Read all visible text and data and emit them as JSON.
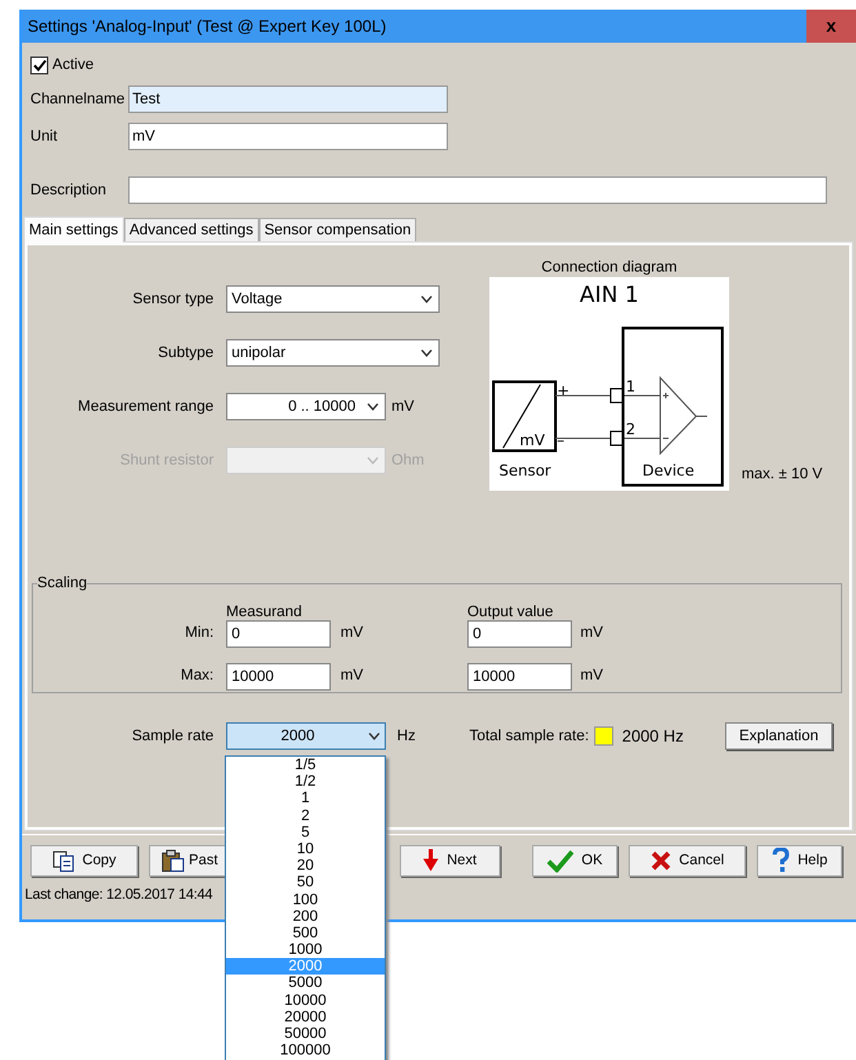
{
  "window": {
    "title": "Settings 'Analog-Input' (Test @ Expert Key 100L)",
    "close": "x"
  },
  "active": {
    "label": "Active",
    "checked": true
  },
  "fields": [
    {
      "label": "Channelname",
      "value": "Test",
      "focused": true,
      "kind": "short"
    },
    {
      "label": "Unit",
      "value": "mV",
      "focused": false,
      "kind": "short"
    },
    {
      "label": "Description",
      "focused": false,
      "kind": "wide"
    }
  ],
  "tabs": [
    {
      "label": "Main settings",
      "selected": true
    },
    {
      "label": "Advanced settings",
      "selected": false
    },
    {
      "label": "Sensor compensation",
      "selected": false
    }
  ],
  "settings": [
    {
      "label": "Sensor type",
      "value": "Voltage",
      "disabled": false,
      "kind": "wide"
    },
    {
      "label": "Subtype",
      "value": "unipolar",
      "disabled": false,
      "kind": "wide"
    },
    {
      "label": "Measurement range",
      "value": "0 .. 10000",
      "unit": "mV",
      "disabled": false,
      "kind": "narrow"
    },
    {
      "label": "Shunt resistor",
      "unit": "Ohm",
      "disabled": true,
      "kind": "narrow"
    }
  ],
  "diagram": {
    "title": "Connection diagram",
    "channel": "AIN 1",
    "plus": "+",
    "minus": "–",
    "pins": [
      "1",
      "2"
    ],
    "sensor_unit": "mV",
    "sensor_label": "Sensor",
    "device_label": "Device",
    "limit": "max. ± 10 V"
  },
  "scaling": {
    "title": "Scaling",
    "columns": [
      "Measurand",
      "Output value"
    ],
    "rows": [
      {
        "label": "Min:",
        "measurand": "0",
        "measurand_unit": "mV",
        "output": "0",
        "output_unit": "mV"
      },
      {
        "label": "Max:",
        "measurand": "10000",
        "measurand_unit": "mV",
        "output": "10000",
        "output_unit": "mV"
      }
    ]
  },
  "sample_rate": {
    "label": "Sample rate",
    "value": "2000",
    "unit": "Hz",
    "total_label": "Total sample rate:",
    "total_indicator": {
      "color": "#ffff00"
    },
    "total_value": "2000 Hz",
    "explanation": "Explanation",
    "options": [
      {
        "label": "1/5",
        "selected": false
      },
      {
        "label": "1/2",
        "selected": false
      },
      {
        "label": "1",
        "selected": false
      },
      {
        "label": "2",
        "selected": false
      },
      {
        "label": "5",
        "selected": false
      },
      {
        "label": "10",
        "selected": false
      },
      {
        "label": "20",
        "selected": false
      },
      {
        "label": "50",
        "selected": false
      },
      {
        "label": "100",
        "selected": false
      },
      {
        "label": "200",
        "selected": false
      },
      {
        "label": "500",
        "selected": false
      },
      {
        "label": "1000",
        "selected": false
      },
      {
        "label": "2000",
        "selected": true
      },
      {
        "label": "5000",
        "selected": false
      },
      {
        "label": "10000",
        "selected": false
      },
      {
        "label": "20000",
        "selected": false
      },
      {
        "label": "50000",
        "selected": false
      },
      {
        "label": "100000",
        "selected": false
      }
    ]
  },
  "buttons": [
    {
      "label": "Copy",
      "kind": "copy"
    },
    {
      "label": "Past",
      "kind": "paste"
    },
    {
      "label": "Next",
      "kind": "next"
    },
    {
      "label": "OK",
      "kind": "ok"
    },
    {
      "label": "Cancel",
      "kind": "cancel"
    },
    {
      "label": "Help",
      "kind": "help"
    }
  ],
  "status": "Last change: 12.05.2017 14:44"
}
